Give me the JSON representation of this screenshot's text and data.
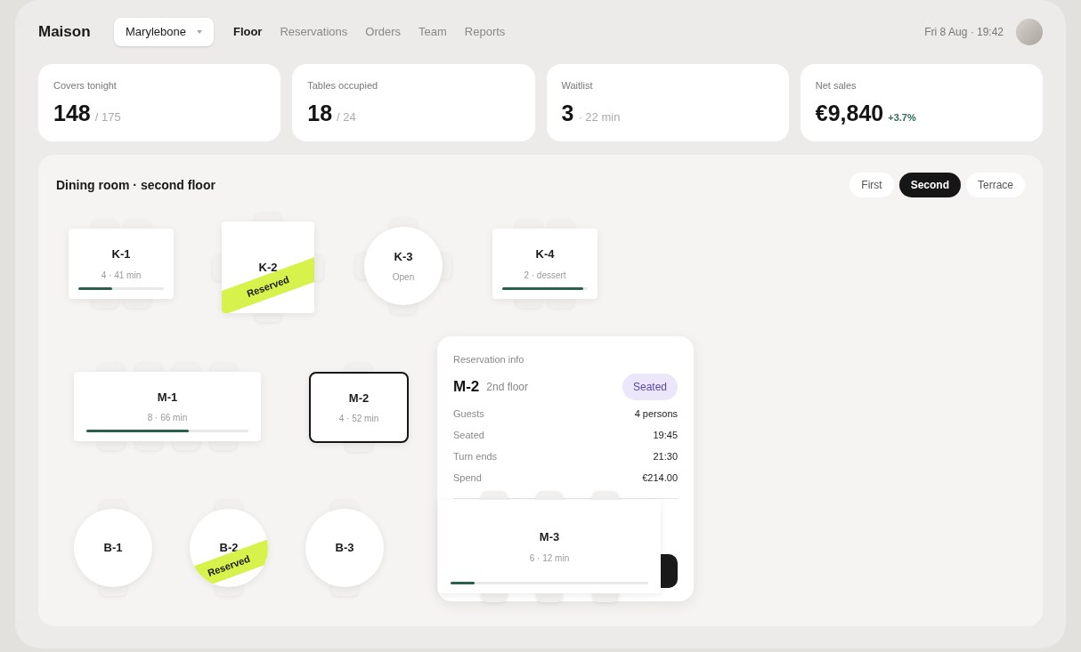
{
  "header": {
    "brand": "Maison",
    "location": "Marylebone",
    "datetime": "Fri 8 Aug · 19:42",
    "nav": [
      {
        "label": "Floor",
        "selected": true
      },
      {
        "label": "Reservations",
        "selected": false
      },
      {
        "label": "Orders",
        "selected": false
      },
      {
        "label": "Team",
        "selected": false
      },
      {
        "label": "Reports",
        "selected": false
      }
    ]
  },
  "stats": [
    {
      "label": "Covers tonight",
      "value": "148",
      "detail": "/ 175"
    },
    {
      "label": "Tables occupied",
      "value": "18",
      "detail": "/ 24"
    },
    {
      "label": "Waitlist",
      "value": "3",
      "detail": "· 22 min"
    },
    {
      "label": "Net sales",
      "value": "€9,840",
      "change": "+3.7%"
    }
  ],
  "floor": {
    "title": "Dining room · second floor",
    "floors": [
      {
        "label": "First",
        "selected": false
      },
      {
        "label": "Second",
        "selected": true
      },
      {
        "label": "Terrace",
        "selected": false
      }
    ],
    "tables": [
      {
        "name": "K-1",
        "kind": "rect",
        "detail": "4 · 41 min",
        "level": 0.4,
        "selected": false
      },
      {
        "name": "K-2",
        "kind": "rect",
        "ribbon": "Reserved",
        "selected": false
      },
      {
        "name": "K-3",
        "kind": "round",
        "detail": "Open",
        "selected": false
      },
      {
        "name": "K-4",
        "kind": "rect",
        "detail": "2 · dessert",
        "level": 0.95,
        "selected": false
      },
      {
        "name": "M-1",
        "kind": "rect",
        "detail": "8 · 66 min",
        "level": 0.63,
        "selected": false
      },
      {
        "name": "M-2",
        "kind": "rect",
        "detail": "4 · 52 min",
        "selected": true
      },
      {
        "name": "B-1",
        "kind": "round",
        "selected": false
      },
      {
        "name": "B-2",
        "kind": "round",
        "ribbon": "Reserved",
        "selected": false
      },
      {
        "name": "B-3",
        "kind": "round",
        "selected": false
      },
      {
        "name": "M-3",
        "kind": "rect",
        "detail": "6 · 12 min",
        "level": 0.12,
        "selected": false
      }
    ],
    "reservation_info": {
      "heading": "Reservation info",
      "table": "M-2",
      "floor": "2nd floor",
      "status": "Seated",
      "rows": [
        {
          "label": "Guests",
          "value": "4 persons"
        },
        {
          "label": "Seated",
          "value": "19:45"
        },
        {
          "label": "Turn ends",
          "value": "21:30"
        },
        {
          "label": "Spend",
          "value": "€214.00"
        }
      ]
    }
  }
}
